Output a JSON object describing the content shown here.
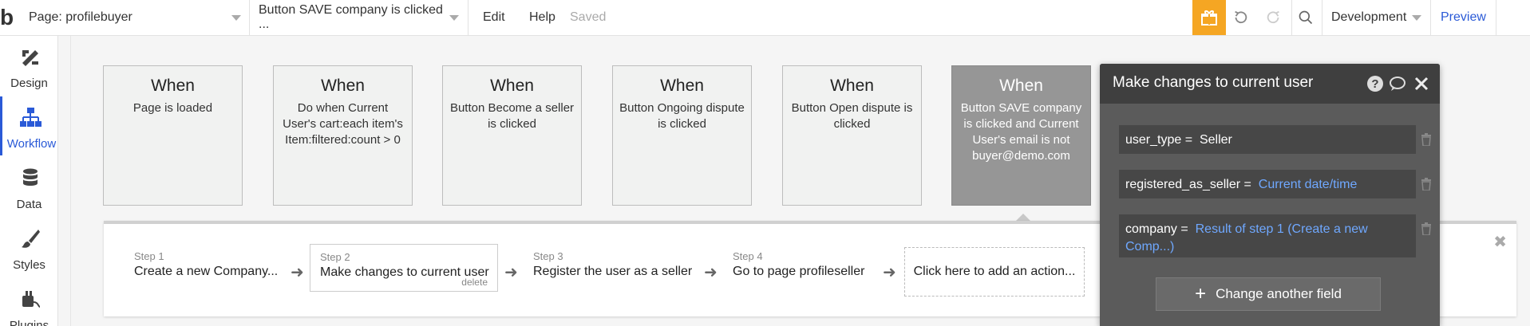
{
  "topbar": {
    "logo": "b",
    "page_selector": "Page: profilebuyer",
    "workflow_selector": "Button SAVE company is clicked ...",
    "menu_edit": "Edit",
    "menu_help": "Help",
    "save_status": "Saved",
    "environment": "Development",
    "preview": "Preview",
    "accent_color": "#f5a623",
    "link_color": "#2a5ad7"
  },
  "sidebar": {
    "items": [
      {
        "label": "Design",
        "icon": "design-icon"
      },
      {
        "label": "Workflow",
        "icon": "workflow-icon",
        "active": true
      },
      {
        "label": "Data",
        "icon": "data-icon"
      },
      {
        "label": "Styles",
        "icon": "styles-icon"
      },
      {
        "label": "Plugins",
        "icon": "plugins-icon"
      }
    ]
  },
  "events": [
    {
      "when": "When",
      "desc": "Page is loaded"
    },
    {
      "when": "When",
      "desc": "Do when Current User's cart:each item's Item:filtered:count > 0"
    },
    {
      "when": "When",
      "desc": "Button Become a seller is clicked"
    },
    {
      "when": "When",
      "desc": "Button Ongoing dispute is clicked"
    },
    {
      "when": "When",
      "desc": "Button Open dispute is clicked"
    },
    {
      "when": "When",
      "desc": "Button SAVE company is clicked and Current User's email is not buyer@demo.com",
      "selected": true
    }
  ],
  "steps": [
    {
      "num": "Step 1",
      "name": "Create a new Company..."
    },
    {
      "num": "Step 2",
      "name": "Make changes to current user",
      "current": true,
      "delete": "delete"
    },
    {
      "num": "Step 3",
      "name": "Register the user as a seller"
    },
    {
      "num": "Step 4",
      "name": "Go to page profileseller"
    }
  ],
  "add_action": "Click here to add an action...",
  "editor": {
    "title": "Make changes to current user",
    "fields": [
      {
        "key": "user_type",
        "eq": " = ",
        "value": "Seller",
        "dynamic": false
      },
      {
        "key": "registered_as_seller",
        "eq": " = ",
        "value": "Current date/time",
        "dynamic": true
      },
      {
        "key": "company",
        "eq": " = ",
        "value": "Result of step 1 (Create a new Comp...)",
        "dynamic": true
      }
    ],
    "change_button": "Change another field"
  }
}
